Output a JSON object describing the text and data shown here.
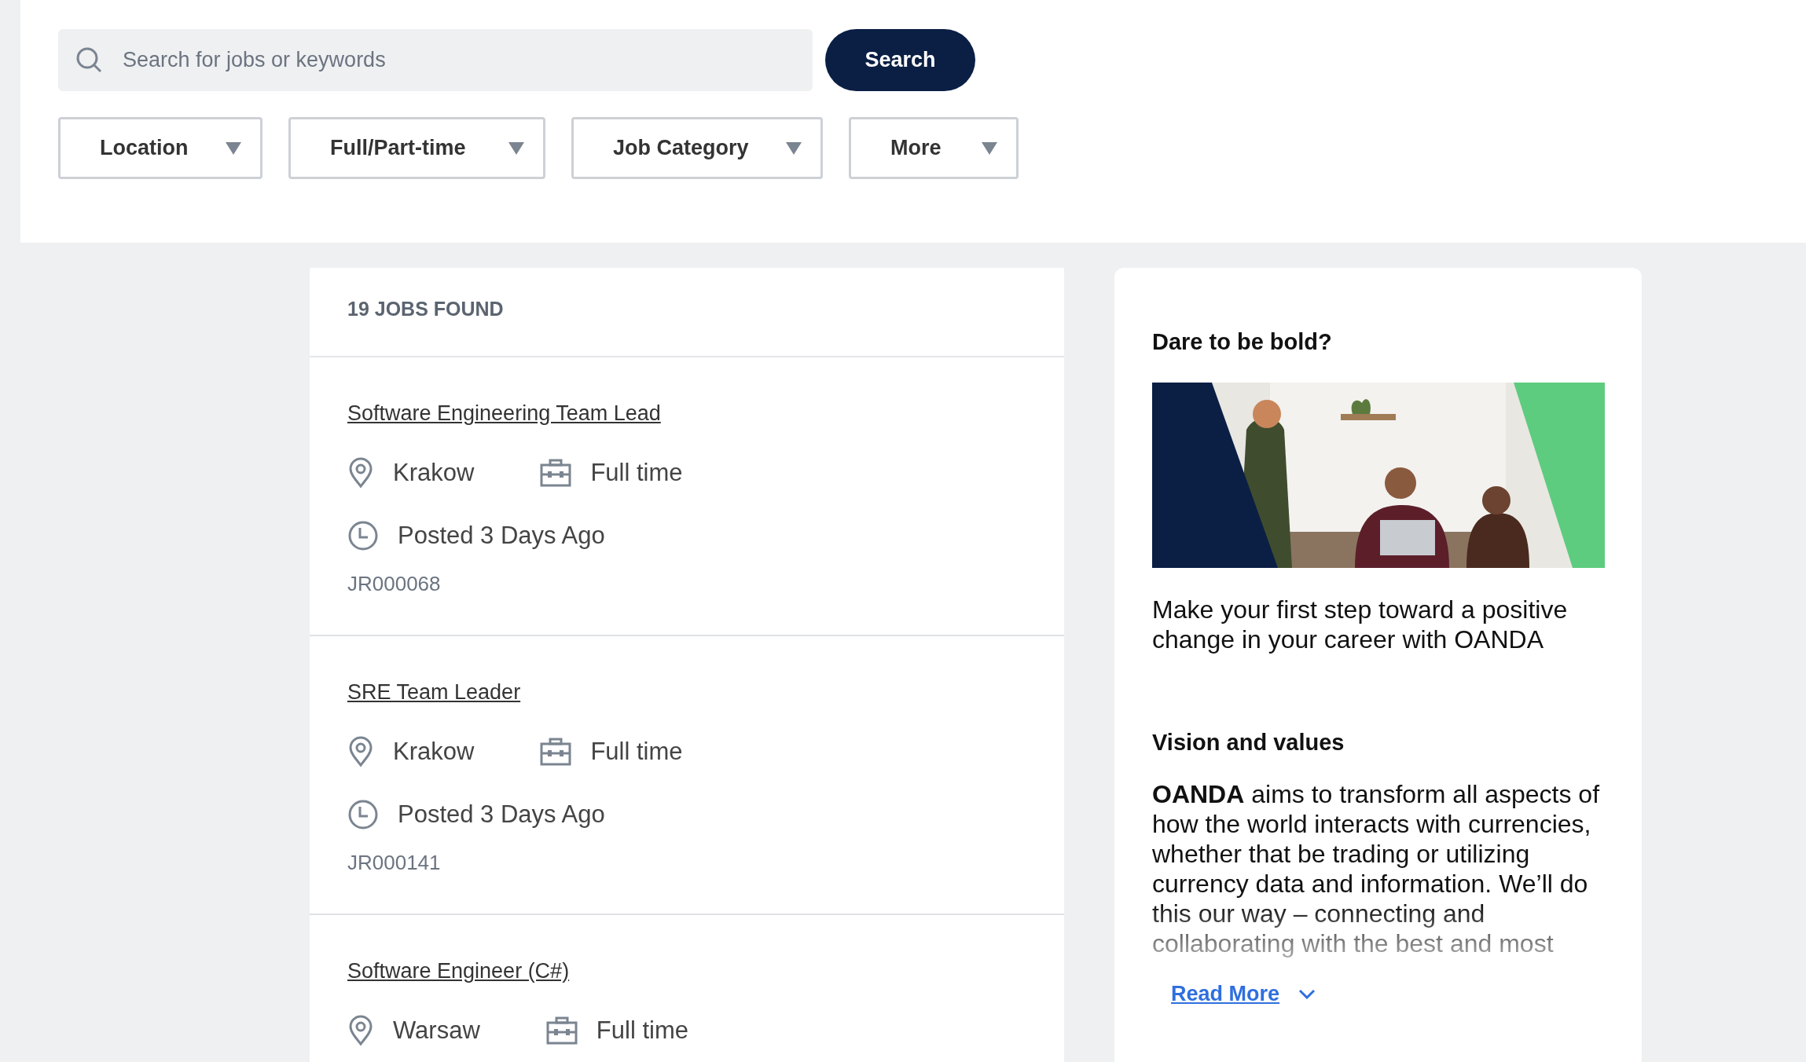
{
  "search": {
    "placeholder": "Search for jobs or keywords",
    "button": "Search"
  },
  "filters": [
    {
      "label": "Location"
    },
    {
      "label": "Full/Part-time"
    },
    {
      "label": "Job Category"
    },
    {
      "label": "More"
    }
  ],
  "results": {
    "count_label": "19 JOBS FOUND",
    "jobs": [
      {
        "title": "Software Engineering Team Lead",
        "location": "Krakow",
        "type": "Full time",
        "posted": "Posted 3 Days Ago",
        "id": "JR000068"
      },
      {
        "title": "SRE Team Leader",
        "location": "Krakow",
        "type": "Full time",
        "posted": "Posted 3 Days Ago",
        "id": "JR000141"
      },
      {
        "title": "Software Engineer (C#)",
        "location": "Warsaw",
        "type": "Full time"
      }
    ]
  },
  "sidebar": {
    "heading": "Dare to be bold?",
    "tagline": "Make your first step toward a positive change in your career with OANDA",
    "section_heading": "Vision and values",
    "paragraph": "**OANDA** aims to transform all aspects of how the world interacts with currencies, whether that be trading or utilizing currency data and information. We’ll do this our way – connecting and collaborating with the best and most",
    "read_more": "Read More"
  }
}
